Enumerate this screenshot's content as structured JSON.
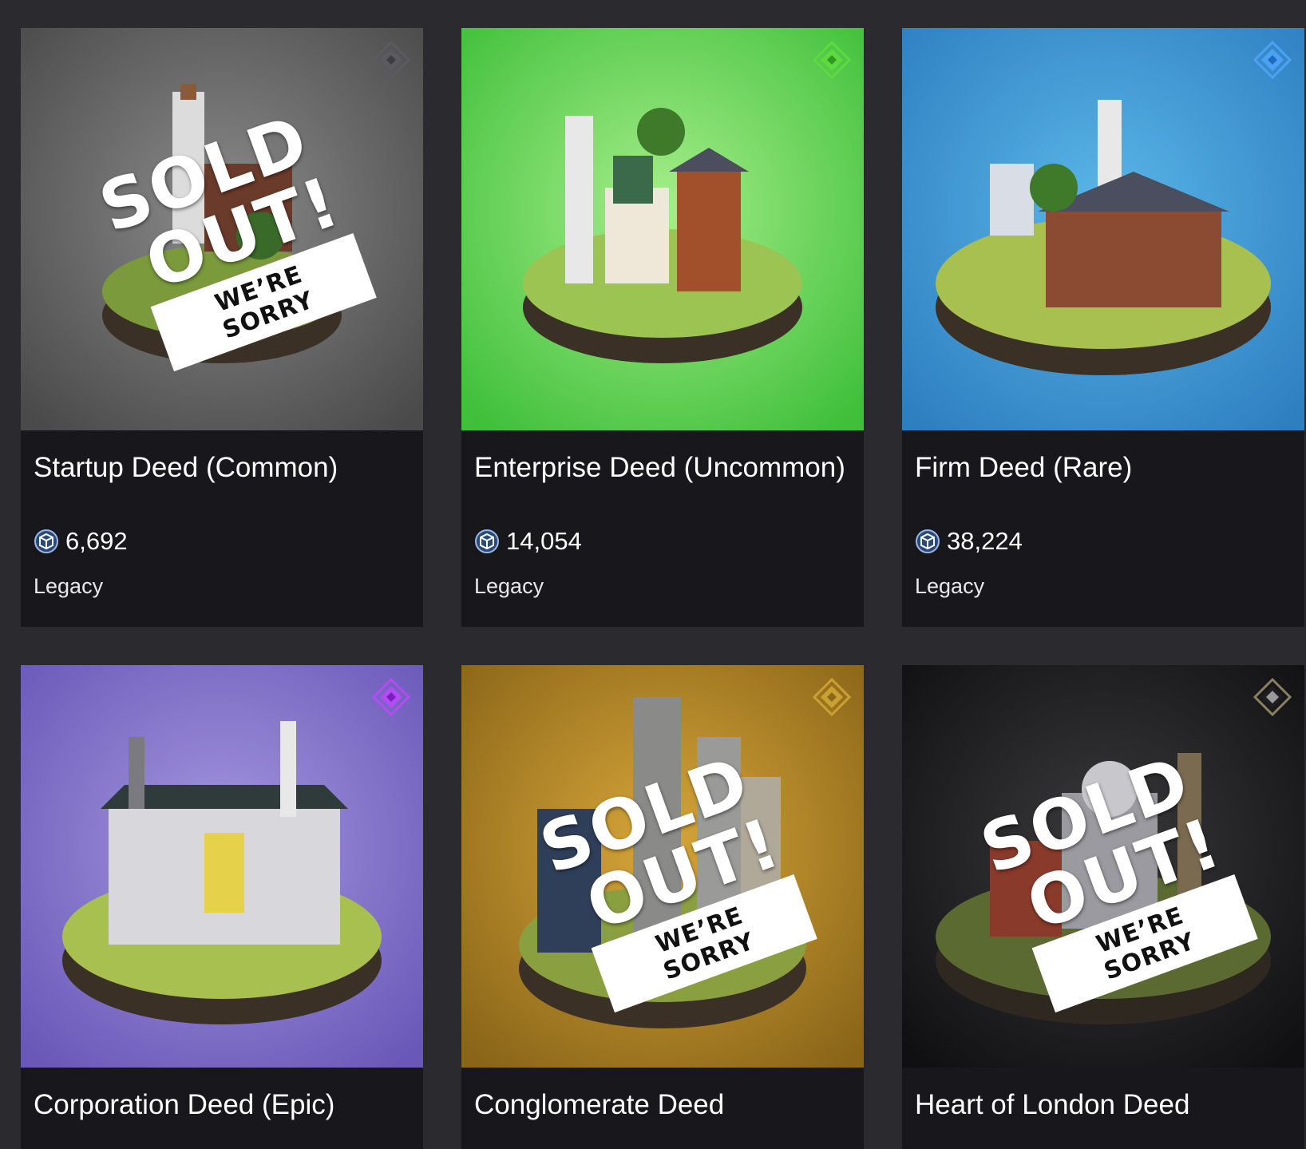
{
  "cards": [
    {
      "title": "Startup Deed (Common)",
      "price": "6,692",
      "label": "Legacy",
      "rarity": "common",
      "rarity_color": "#5a5a60",
      "background": [
        "#8a8a8a",
        "#4a4a4a"
      ],
      "sold_out": true,
      "sold_text": [
        "SOLD",
        "OUT!"
      ],
      "sorry_text": "WE’RE SORRY"
    },
    {
      "title": "Enterprise Deed (Uncommon)",
      "price": "14,054",
      "label": "Legacy",
      "rarity": "uncommon",
      "rarity_color": "#5fd940",
      "background": [
        "#a6ee8a",
        "#3fbf3a"
      ],
      "sold_out": false
    },
    {
      "title": "Firm Deed (Rare)",
      "price": "38,224",
      "label": "Legacy",
      "rarity": "rare",
      "rarity_color": "#4ba2f5",
      "background": [
        "#5ab6e8",
        "#2e7fc0"
      ],
      "sold_out": false
    },
    {
      "title": "Corporation Deed (Epic)",
      "rarity": "epic",
      "rarity_color": "#b34cf5",
      "background": [
        "#a397de",
        "#6a58b8"
      ],
      "sold_out": false
    },
    {
      "title": "Conglomerate Deed",
      "rarity": "legendary",
      "rarity_color": "#c9a133",
      "background": [
        "#d7a63a",
        "#8a6518"
      ],
      "sold_out": true,
      "sold_text": [
        "SOLD",
        "OUT!"
      ],
      "sorry_text": "WE’RE SORRY"
    },
    {
      "title": "Heart of London Deed",
      "rarity": "ancient",
      "rarity_color": "#8a8060",
      "background": [
        "#3a3a3c",
        "#101012"
      ],
      "sold_out": true,
      "sold_text": [
        "SOLD",
        "OUT!"
      ],
      "sorry_text": "WE’RE SORRY"
    }
  ],
  "icons": {
    "rarity": "rarity-diamond-icon",
    "price": "currency-cube-icon"
  }
}
